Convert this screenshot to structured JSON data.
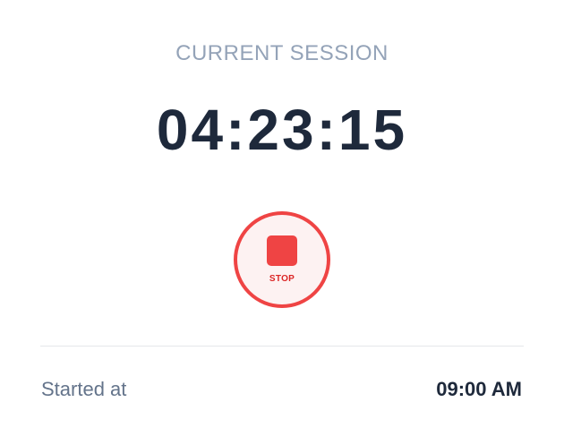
{
  "session": {
    "label": "CURRENT SESSION",
    "elapsed": "04:23:15"
  },
  "controls": {
    "stop_label": "STOP",
    "stop_icon": "stop-square-icon",
    "accent_color": "#ef4444"
  },
  "details": {
    "started_label": "Started at",
    "started_value": "09:00 AM"
  }
}
